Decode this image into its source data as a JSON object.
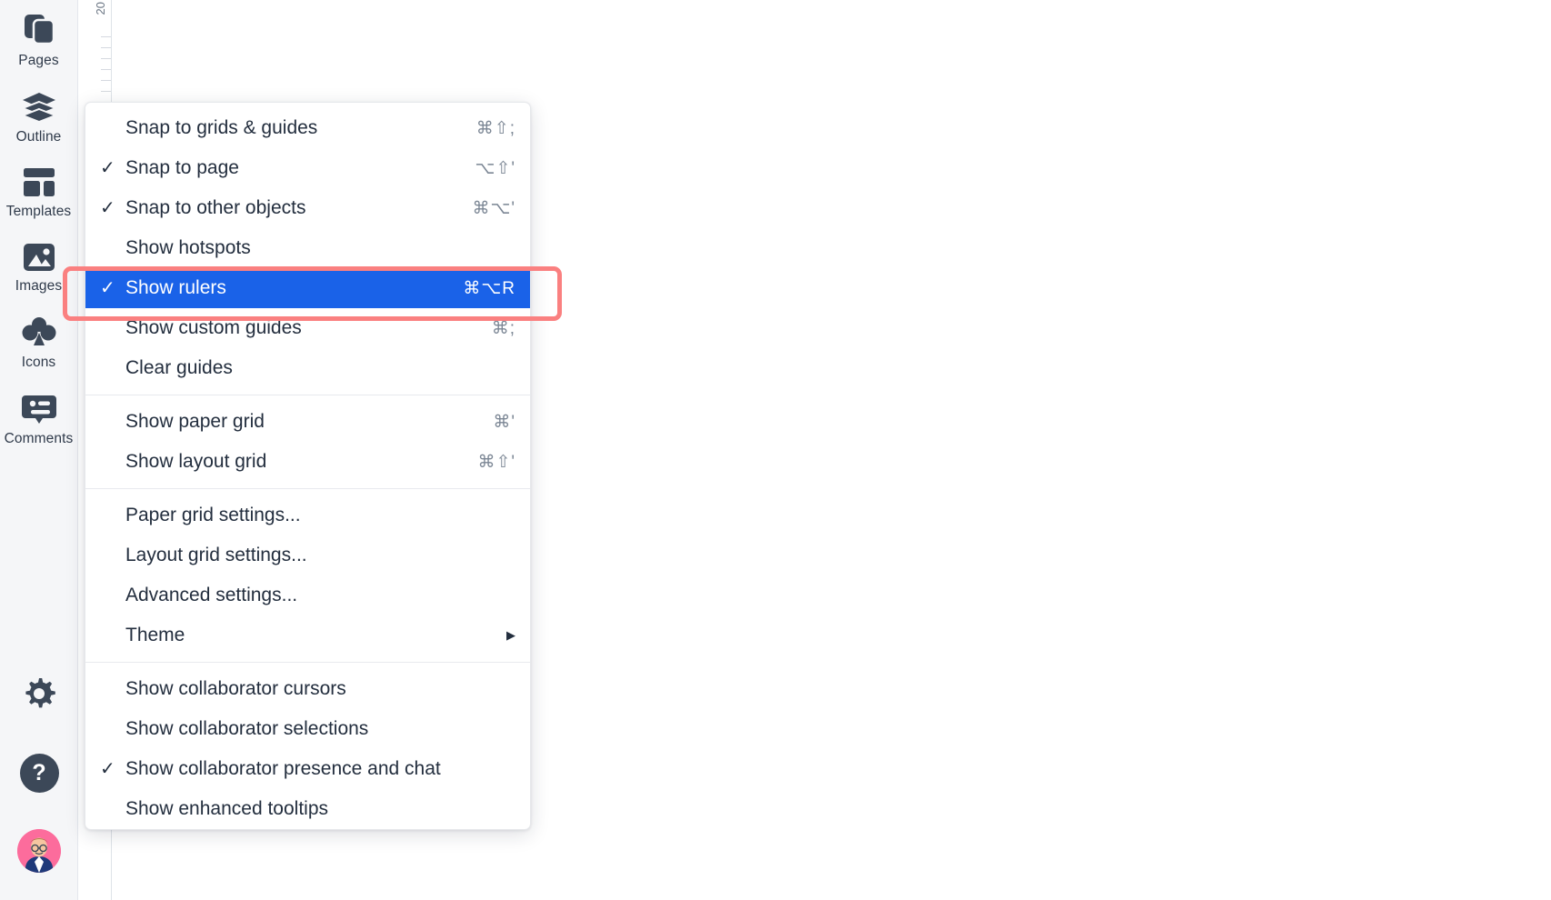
{
  "sidebar": {
    "items": [
      {
        "label": "Pages",
        "icon": "pages-icon"
      },
      {
        "label": "Outline",
        "icon": "layers-icon"
      },
      {
        "label": "Templates",
        "icon": "templates-icon"
      },
      {
        "label": "Images",
        "icon": "image-icon"
      },
      {
        "label": "Icons",
        "icon": "clover-icon"
      },
      {
        "label": "Comments",
        "icon": "comment-icon"
      }
    ],
    "bottom": [
      {
        "name": "settings-button",
        "icon": "gear-icon"
      },
      {
        "name": "help-button",
        "icon": "question-icon",
        "glyph": "?"
      },
      {
        "name": "user-avatar",
        "icon": "avatar-icon"
      }
    ]
  },
  "ruler": {
    "label": "20"
  },
  "menu": {
    "groups": [
      {
        "items": [
          {
            "checked": false,
            "label": "Snap to grids & guides",
            "shortcut": "⌘⇧;",
            "selected": false
          },
          {
            "checked": true,
            "label": "Snap to page",
            "shortcut": "⌥⇧'",
            "selected": false
          },
          {
            "checked": true,
            "label": "Snap to other objects",
            "shortcut": "⌘⌥'",
            "selected": false
          },
          {
            "checked": false,
            "label": "Show hotspots",
            "shortcut": "",
            "selected": false
          },
          {
            "checked": true,
            "label": "Show rulers",
            "shortcut": "⌘⌥R",
            "selected": true
          },
          {
            "checked": false,
            "label": "Show custom guides",
            "shortcut": "⌘;",
            "selected": false
          },
          {
            "checked": false,
            "label": "Clear guides",
            "shortcut": "",
            "selected": false
          }
        ]
      },
      {
        "items": [
          {
            "checked": false,
            "label": "Show paper grid",
            "shortcut": "⌘'",
            "selected": false
          },
          {
            "checked": false,
            "label": "Show layout grid",
            "shortcut": "⌘⇧'",
            "selected": false
          }
        ]
      },
      {
        "items": [
          {
            "checked": false,
            "label": "Paper grid settings...",
            "shortcut": "",
            "selected": false
          },
          {
            "checked": false,
            "label": "Layout grid settings...",
            "shortcut": "",
            "selected": false
          },
          {
            "checked": false,
            "label": "Advanced settings...",
            "shortcut": "",
            "selected": false
          },
          {
            "checked": false,
            "label": "Theme",
            "shortcut": "",
            "submenu": true,
            "selected": false
          }
        ]
      },
      {
        "items": [
          {
            "checked": false,
            "label": "Show collaborator cursors",
            "shortcut": "",
            "selected": false
          },
          {
            "checked": false,
            "label": "Show collaborator selections",
            "shortcut": "",
            "selected": false
          },
          {
            "checked": true,
            "label": "Show collaborator presence and chat",
            "shortcut": "",
            "selected": false
          },
          {
            "checked": false,
            "label": "Show enhanced tooltips",
            "shortcut": "",
            "selected": false
          }
        ]
      }
    ],
    "submenu_caret": "▶",
    "check_glyph": "✓"
  },
  "annotation": {
    "highlight_target": "Show rulers",
    "highlight_color": "#fa8080"
  },
  "colors": {
    "selected_bg": "#1a62e8",
    "sidebar_bg": "#f5f6f8",
    "icon": "#3c4858",
    "text": "#232e3e",
    "shortcut": "#7b8694"
  }
}
